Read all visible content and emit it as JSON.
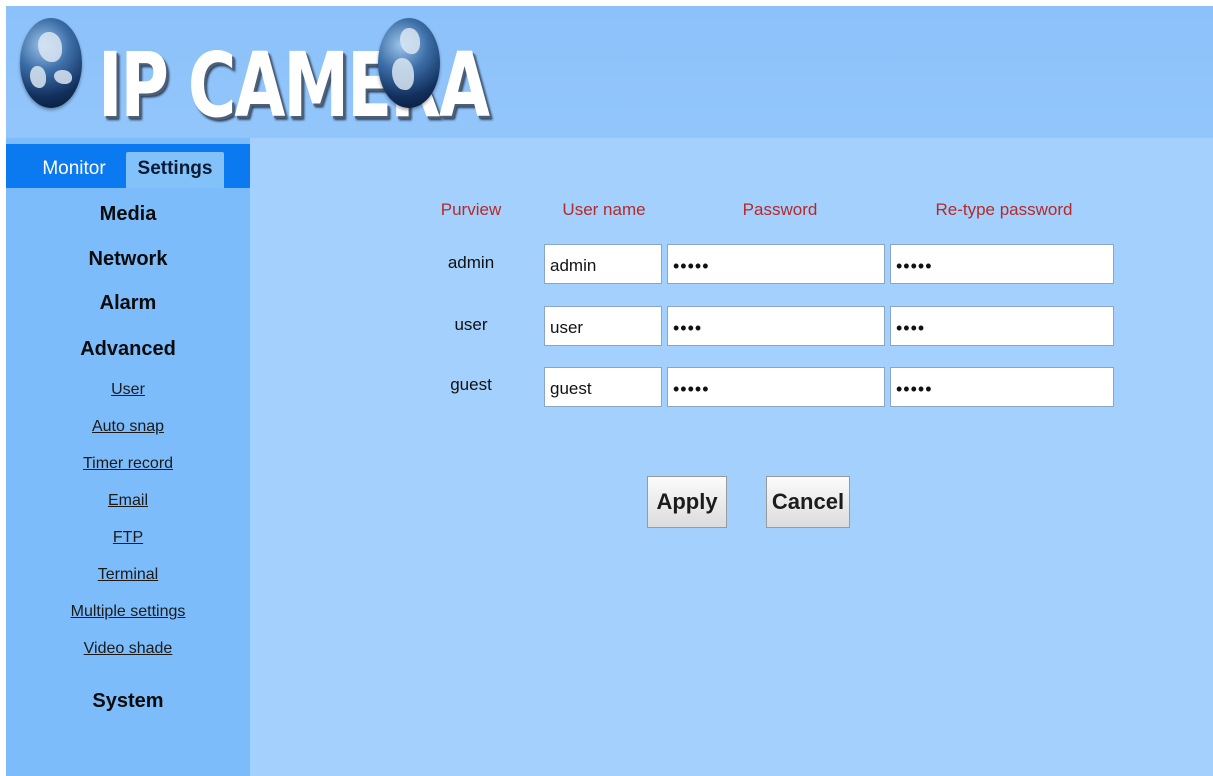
{
  "header": {
    "logo_text": "IP CAMERA"
  },
  "tabs": {
    "monitor": "Monitor",
    "settings": "Settings"
  },
  "sidebar": {
    "main_items": [
      "Media",
      "Network",
      "Alarm",
      "Advanced"
    ],
    "sub_items": [
      "User",
      "Auto snap",
      "Timer record",
      "Email",
      "FTP",
      "Terminal",
      "Multiple settings",
      "Video shade"
    ],
    "system": "System"
  },
  "form": {
    "headers": {
      "purview": "Purview",
      "username": "User name",
      "password": "Password",
      "retype": "Re-type password"
    },
    "rows": [
      {
        "purview": "admin",
        "username": "admin",
        "password": "•••••",
        "retype": "•••••"
      },
      {
        "purview": "user",
        "username": "user",
        "password": "••••",
        "retype": "••••"
      },
      {
        "purview": "guest",
        "username": "guest",
        "password": "•••••",
        "retype": "•••••"
      }
    ]
  },
  "buttons": {
    "apply": "Apply",
    "cancel": "Cancel"
  },
  "colors": {
    "header_bg": "#8fc4fb",
    "tabbar_bg": "#0b79f0",
    "sidebar_bg": "#7cbcfb",
    "content_bg": "#a3d0fc",
    "column_header": "#b52a2a"
  }
}
